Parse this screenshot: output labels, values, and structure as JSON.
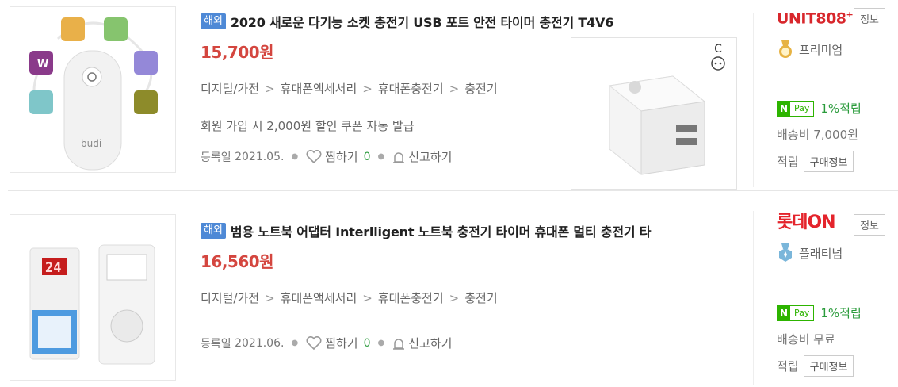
{
  "items": [
    {
      "badge": "해외",
      "title": "2020 새로운 다기능 소켓 충전기 USB 포트 안전 타이머 충전기 T4V6",
      "price": "15,700원",
      "category": [
        "디지털/가전",
        "휴대폰액세서리",
        "휴대폰충전기",
        "충전기"
      ],
      "promo": "회원 가입 시 2,000원 할인 쿠폰 자동 발급",
      "reg_label": "등록일",
      "reg_date": "2021.05.",
      "wish_label": "찜하기",
      "wish_count": "0",
      "report_label": "신고하기",
      "thumb_text": "budi",
      "side_badge": "C",
      "seller": {
        "logo": "UNIT808",
        "logo_sup": "+",
        "info_label": "정보",
        "grade": "프리미엄",
        "npay_n": "N",
        "npay_text": "Pay",
        "npay_label": "1%적립",
        "shipping": "배송비 7,000원",
        "accum_label": "적립",
        "buy_info_label": "구매정보"
      }
    },
    {
      "badge": "해외",
      "title": "범용 노트북 어댑터 Interlligent 노트북 충전기 타이머 휴대폰 멀티 충전기 타",
      "price": "16,560원",
      "category": [
        "디지털/가전",
        "휴대폰액세서리",
        "휴대폰충전기",
        "충전기"
      ],
      "reg_label": "등록일",
      "reg_date": "2021.06.",
      "wish_label": "찜하기",
      "wish_count": "0",
      "report_label": "신고하기",
      "thumb_display": "24",
      "seller": {
        "logo": "롯데ON",
        "info_label": "정보",
        "grade": "플래티넘",
        "npay_n": "N",
        "npay_text": "Pay",
        "npay_label": "1%적립",
        "shipping": "배송비 무료",
        "accum_label": "적립",
        "buy_info_label": "구매정보"
      }
    }
  ],
  "colors": {
    "price": "#d4463f",
    "badge": "#4e89d6",
    "npay": "#2db400",
    "count": "#2a9b3b"
  }
}
